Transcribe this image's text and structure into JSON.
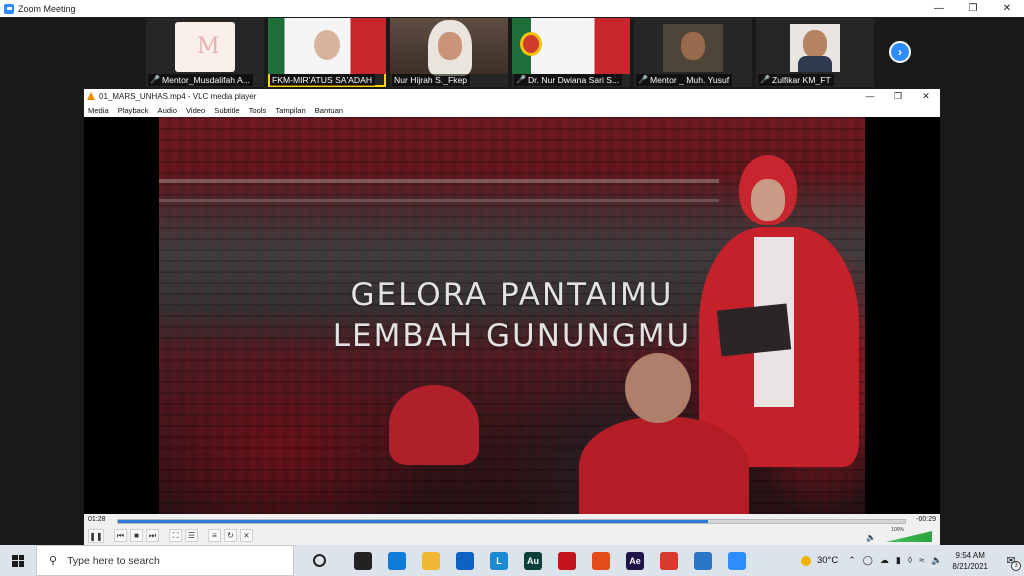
{
  "zoom": {
    "title": "Zoom Meeting",
    "participants": [
      {
        "name": "Mentor_Musdalifah A...",
        "muted": true,
        "pic": "logo-M"
      },
      {
        "name": "FKM-MIR'ATUS SA'ADAH",
        "muted": false,
        "pic": "webcam",
        "active": true
      },
      {
        "name": "Nur Hijrah S._Fkep",
        "muted": false,
        "pic": "webcam"
      },
      {
        "name": "Dr. Nur Dwiana Sari S...",
        "muted": true,
        "pic": "webcam"
      },
      {
        "name": "Mentor _ Muh. Yusuf",
        "muted": true,
        "pic": "webcam"
      },
      {
        "name": "Zulfikar KM_FT",
        "muted": true,
        "pic": "webcam"
      }
    ],
    "next_icon": "chevron-right-icon"
  },
  "vlc": {
    "title": "01_MARS_UNHAS.mp4 - VLC media player",
    "menu": [
      "Media",
      "Playback",
      "Audio",
      "Video",
      "Subtitle",
      "Tools",
      "Tampilan",
      "Bantuan"
    ],
    "caption_line1": "GELORA PANTAIMU",
    "caption_line2": "LEMBAH GUNUNGMU",
    "elapsed": "01:28",
    "remaining": "-00:29",
    "progress": 0.75,
    "volume_label": "100%",
    "accent": "#2b7ad6"
  },
  "taskbar": {
    "search_placeholder": "Type here to search",
    "apps": [
      {
        "name": "task-view-icon",
        "label": "",
        "color": "#222222"
      },
      {
        "name": "edge-icon",
        "label": "",
        "color": "#0f7bd8"
      },
      {
        "name": "file-explorer-icon",
        "label": "",
        "color": "#f2b632"
      },
      {
        "name": "mail-icon",
        "label": "",
        "color": "#0f62c4"
      },
      {
        "name": "launcher-l-icon",
        "label": "L",
        "color": "#1a8ad4"
      },
      {
        "name": "audition-icon",
        "label": "Au",
        "color": "#0b3f3a"
      },
      {
        "name": "mcafee-icon",
        "label": "",
        "color": "#c4141d"
      },
      {
        "name": "office-icon",
        "label": "",
        "color": "#e44b1b"
      },
      {
        "name": "after-effects-icon",
        "label": "Ae",
        "color": "#1e1448"
      },
      {
        "name": "chrome-icon",
        "label": "",
        "color": "#d93a2e"
      },
      {
        "name": "store-icon",
        "label": "",
        "color": "#2a76c7"
      },
      {
        "name": "zoom-icon",
        "label": "",
        "color": "#2d8cff"
      }
    ],
    "weather": "30°C",
    "time": "9:54 AM",
    "date": "8/21/2021",
    "notifications": "3"
  }
}
